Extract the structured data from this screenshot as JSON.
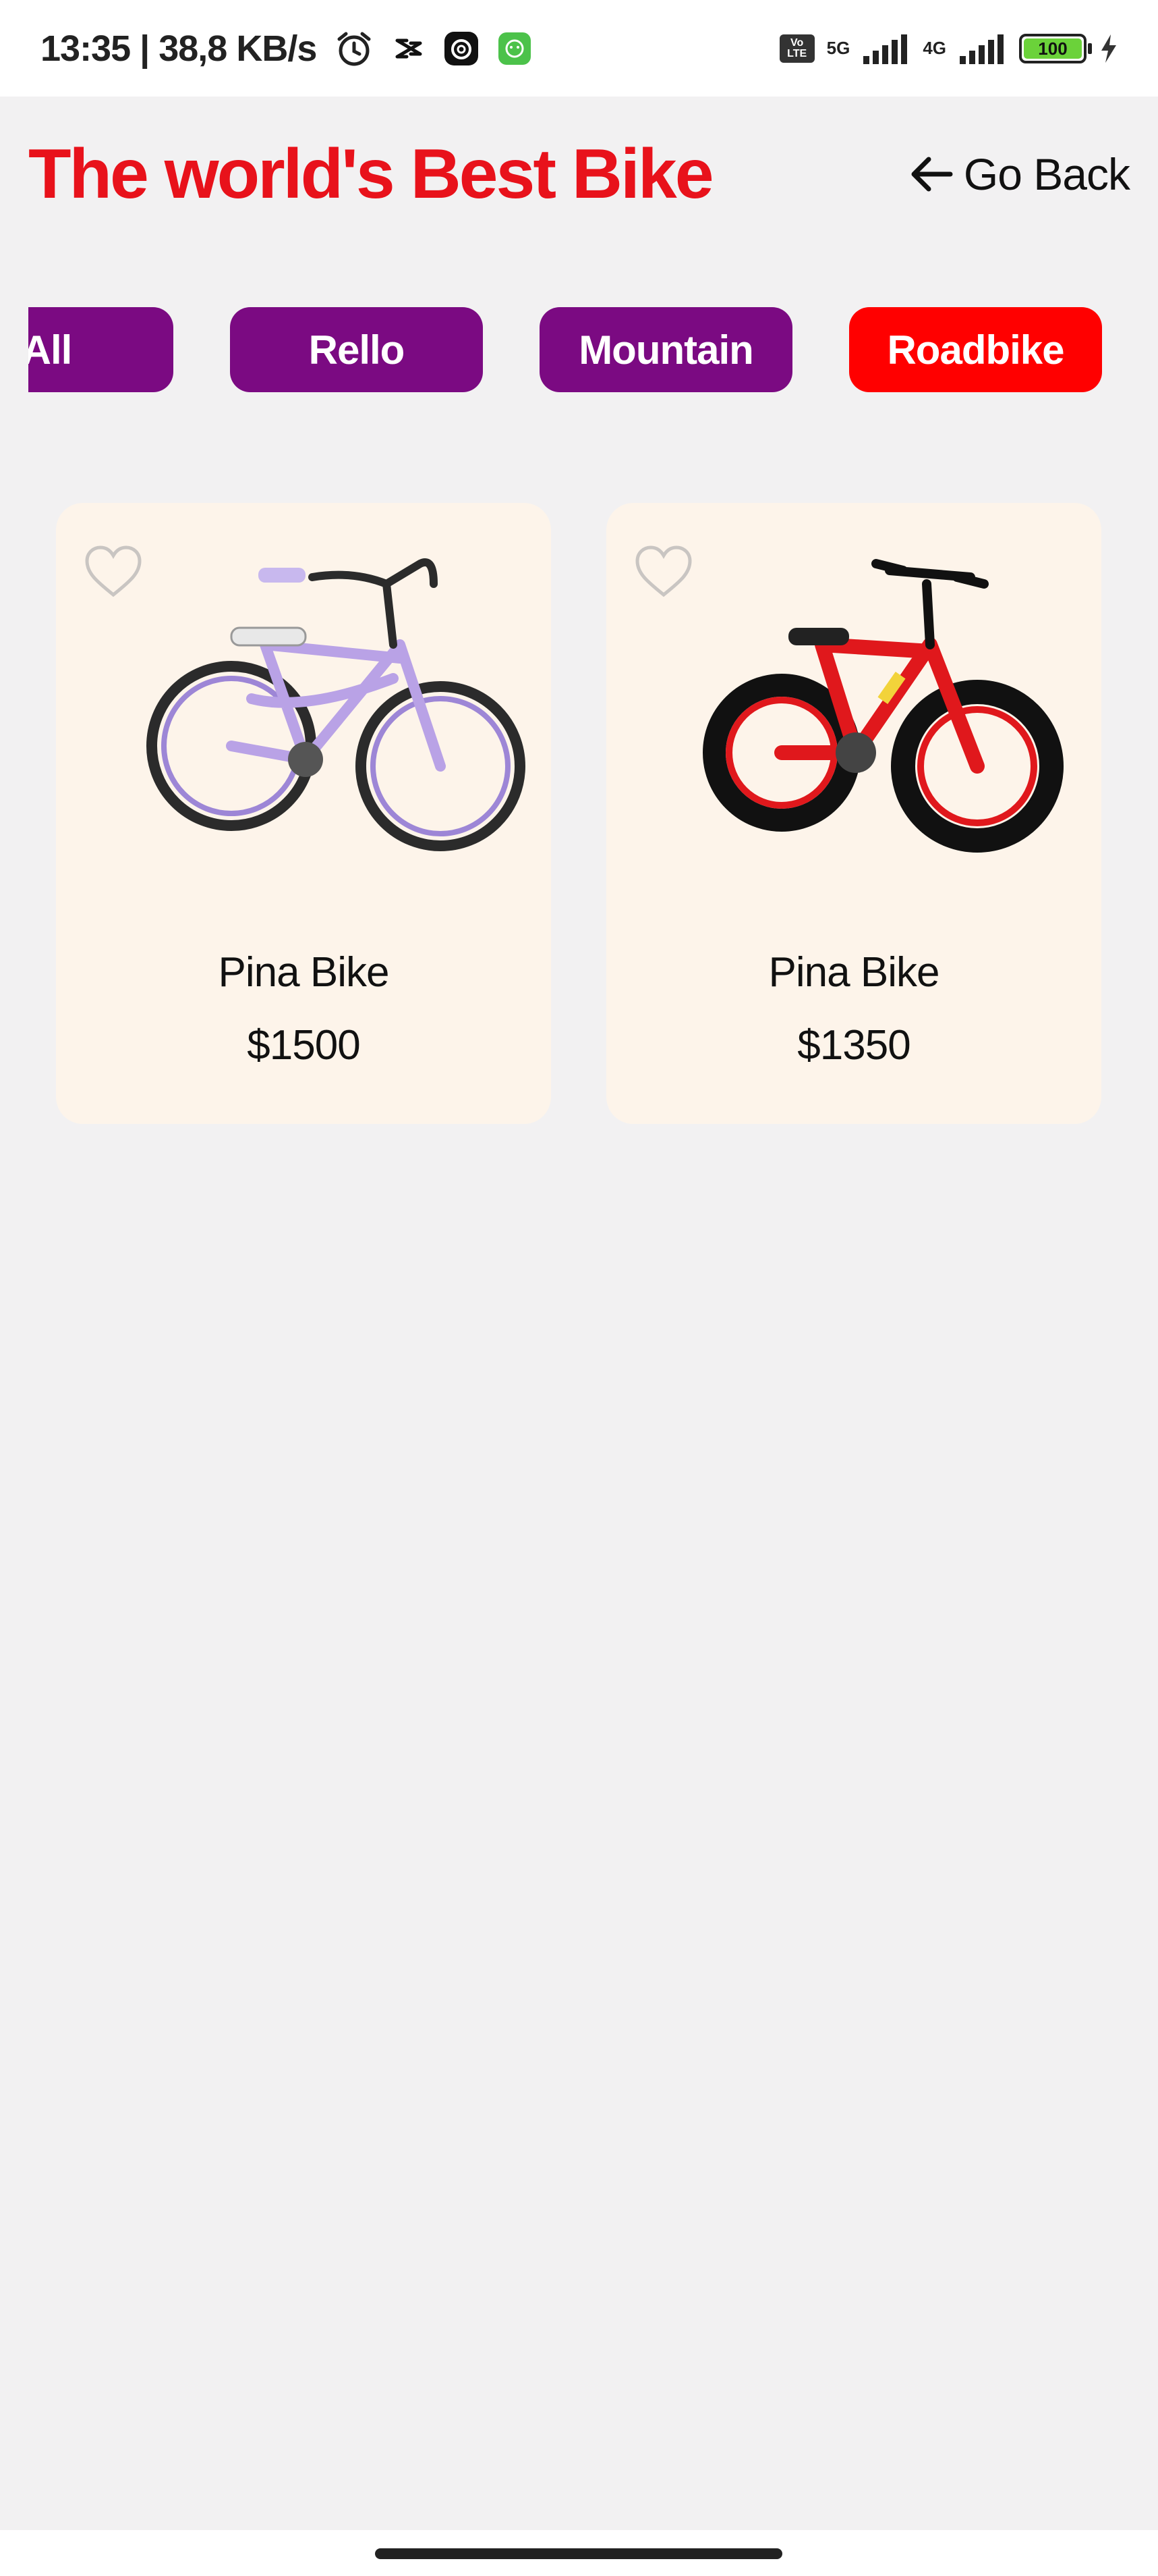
{
  "status_bar": {
    "time_speed": "13:35 | 38,8 KB/s",
    "volte": [
      "Vo",
      "LTE"
    ],
    "net1": "5G",
    "net2": "4G",
    "battery": "100"
  },
  "header": {
    "title": "The world's Best Bike",
    "go_back": "Go Back"
  },
  "categories": [
    {
      "label": "All",
      "active": false
    },
    {
      "label": "Rello",
      "active": false
    },
    {
      "label": "Mountain",
      "active": false
    },
    {
      "label": "Roadbike",
      "active": true
    }
  ],
  "products": [
    {
      "name": "Pina Bike",
      "price": "$1500",
      "frame_color": "#b9a2e6",
      "tire_color": "#2b2b2b",
      "rim_color": "#9d86d6"
    },
    {
      "name": "Pina Bike",
      "price": "$1350",
      "frame_color": "#e0181c",
      "tire_color": "#111111",
      "rim_color": "#e0181c"
    }
  ],
  "colors": {
    "title": "#e8121b",
    "chip": "#7b0a82",
    "chip_active": "#ff0000",
    "card_bg": "#fdf4ea",
    "page_bg": "#f2f1f2"
  },
  "icons": {
    "alarm": "alarm-icon",
    "capcut": "capcut-icon",
    "threads": "threads-icon",
    "app": "app-icon",
    "back": "arrow-left-icon",
    "favorite": "heart-outline-icon"
  }
}
